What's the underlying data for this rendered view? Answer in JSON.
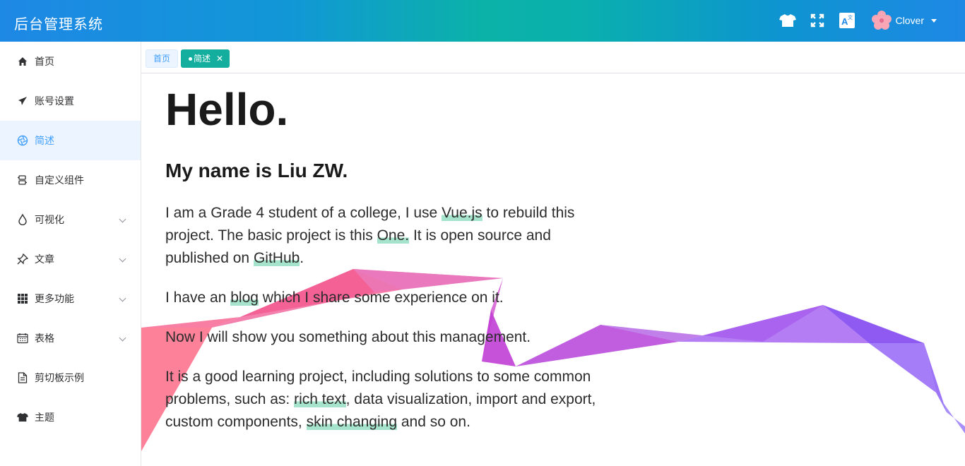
{
  "header": {
    "brand": "后台管理系统",
    "icons": [
      "tshirt-icon",
      "fullscreen-icon",
      "translate-icon"
    ],
    "user_name": "Clover"
  },
  "sidebar": {
    "items": [
      {
        "label": "首页",
        "icon": "home-icon"
      },
      {
        "label": "账号设置",
        "icon": "send-icon"
      },
      {
        "label": "简述",
        "icon": "aperture-icon",
        "active": true
      },
      {
        "label": "自定义组件",
        "icon": "component-icon"
      },
      {
        "label": "可视化",
        "icon": "drop-icon",
        "expandable": true
      },
      {
        "label": "文章",
        "icon": "pin-icon",
        "expandable": true
      },
      {
        "label": "更多功能",
        "icon": "grid-icon",
        "expandable": true
      },
      {
        "label": "表格",
        "icon": "calendar-icon",
        "expandable": true
      },
      {
        "label": "剪切板示例",
        "icon": "document-icon"
      },
      {
        "label": "主题",
        "icon": "tshirt-icon"
      }
    ]
  },
  "tabs": [
    {
      "label": "首页"
    },
    {
      "label": "简述",
      "active": true
    }
  ],
  "content": {
    "title": "Hello.",
    "subtitle": "My name is Liu ZW.",
    "p1": {
      "a": "I am a Grade 4 student of a college, I use ",
      "vue": "Vue.js",
      "b": " to rebuild this project. The basic project is this ",
      "one": "One.",
      "c": " It is open source and published on ",
      "github": "GitHub",
      "d": "."
    },
    "p2": {
      "a": "I have an ",
      "blog": "blog",
      "b": " which I share some experience on it."
    },
    "p3": "Now I will show you something about this management.",
    "p4": {
      "a": "It is a good learning project, including solutions to some common problems, such as: ",
      "rich": "rich text",
      "b": ", data visualization, import and export, custom components, ",
      "skin": "skin changing",
      "c": " and so on."
    }
  },
  "colors": {
    "accent": "#409eff",
    "tab_active": "#13ae9d"
  }
}
